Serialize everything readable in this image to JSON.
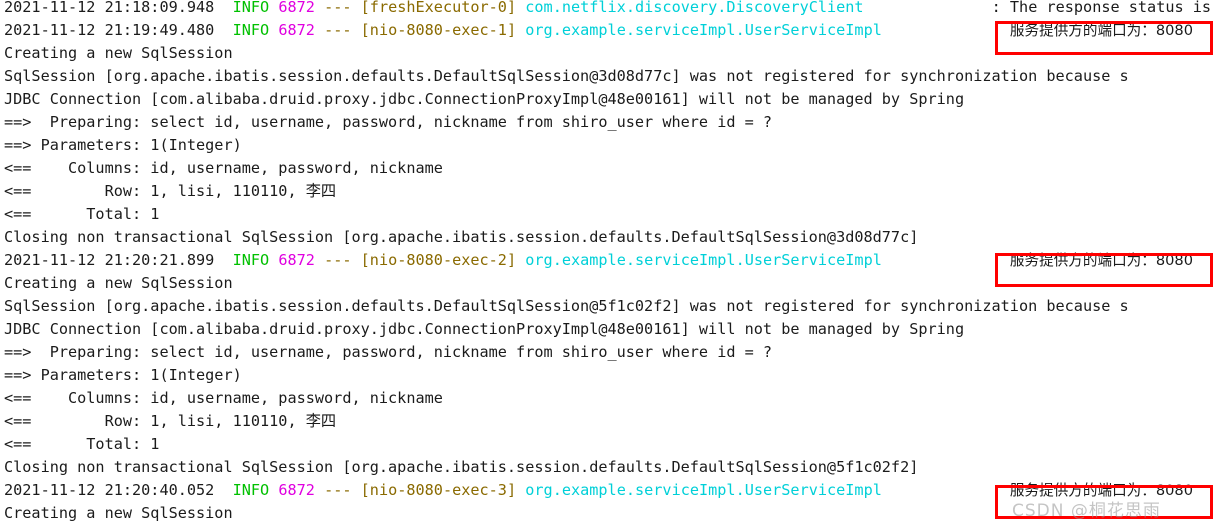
{
  "console": {
    "app": "spring-boot-console-log",
    "colors": {
      "background": "#ffffff",
      "text": "#1b1b1b",
      "info_level": "#00c000",
      "pid": "#e000e0",
      "thread": "#8a6a00",
      "logger": "#00d0d8",
      "highlight_box": "#ff0000",
      "watermark": "#969696"
    },
    "watermark": "CSDN @桐花思雨",
    "lines": [
      {
        "type": "log",
        "timestamp": "2021-11-12 21:18:09.948",
        "level": "INFO",
        "pid": "6872",
        "separator": "---",
        "thread": "[freshExecutor-0]",
        "logger": "com.netflix.discovery.DiscoveryClient",
        "colon": ":",
        "message": "The response status is",
        "clipped_top": true,
        "clipped_right": true
      },
      {
        "type": "log",
        "timestamp": "2021-11-12 21:19:49.480",
        "level": "INFO",
        "pid": "6872",
        "separator": "---",
        "thread": "[nio-8080-exec-1]",
        "logger": "org.example.serviceImpl.UserServiceImpl",
        "colon": ":",
        "message": "服务提供方的端口为：8080",
        "highlighted": true
      },
      {
        "type": "plain",
        "text": "Creating a new SqlSession"
      },
      {
        "type": "plain",
        "text": "SqlSession [org.apache.ibatis.session.defaults.DefaultSqlSession@3d08d77c] was not registered for synchronization because s"
      },
      {
        "type": "plain",
        "text": "JDBC Connection [com.alibaba.druid.proxy.jdbc.ConnectionProxyImpl@48e00161] will not be managed by Spring"
      },
      {
        "type": "plain",
        "text": "==>  Preparing: select id, username, password, nickname from shiro_user where id = ?"
      },
      {
        "type": "plain",
        "text": "==> Parameters: 1(Integer)"
      },
      {
        "type": "plain",
        "text": "<==    Columns: id, username, password, nickname"
      },
      {
        "type": "plain",
        "text": "<==        Row: 1, lisi, 110110, 李四"
      },
      {
        "type": "plain",
        "text": "<==      Total: 1"
      },
      {
        "type": "plain",
        "text": "Closing non transactional SqlSession [org.apache.ibatis.session.defaults.DefaultSqlSession@3d08d77c]"
      },
      {
        "type": "log",
        "timestamp": "2021-11-12 21:20:21.899",
        "level": "INFO",
        "pid": "6872",
        "separator": "---",
        "thread": "[nio-8080-exec-2]",
        "logger": "org.example.serviceImpl.UserServiceImpl",
        "colon": ":",
        "message": "服务提供方的端口为：8080",
        "highlighted": true
      },
      {
        "type": "plain",
        "text": "Creating a new SqlSession"
      },
      {
        "type": "plain",
        "text": "SqlSession [org.apache.ibatis.session.defaults.DefaultSqlSession@5f1c02f2] was not registered for synchronization because s"
      },
      {
        "type": "plain",
        "text": "JDBC Connection [com.alibaba.druid.proxy.jdbc.ConnectionProxyImpl@48e00161] will not be managed by Spring"
      },
      {
        "type": "plain",
        "text": "==>  Preparing: select id, username, password, nickname from shiro_user where id = ?"
      },
      {
        "type": "plain",
        "text": "==> Parameters: 1(Integer)"
      },
      {
        "type": "plain",
        "text": "<==    Columns: id, username, password, nickname"
      },
      {
        "type": "plain",
        "text": "<==        Row: 1, lisi, 110110, 李四"
      },
      {
        "type": "plain",
        "text": "<==      Total: 1"
      },
      {
        "type": "plain",
        "text": "Closing non transactional SqlSession [org.apache.ibatis.session.defaults.DefaultSqlSession@5f1c02f2]"
      },
      {
        "type": "log",
        "timestamp": "2021-11-12 21:20:40.052",
        "level": "INFO",
        "pid": "6872",
        "separator": "---",
        "thread": "[nio-8080-exec-3]",
        "logger": "org.example.serviceImpl.UserServiceImpl",
        "colon": ":",
        "message": "服务提供方的端口为：8080",
        "highlighted": true
      },
      {
        "type": "plain",
        "text": "Creating a new SqlSession",
        "clipped_bottom": true
      }
    ]
  }
}
